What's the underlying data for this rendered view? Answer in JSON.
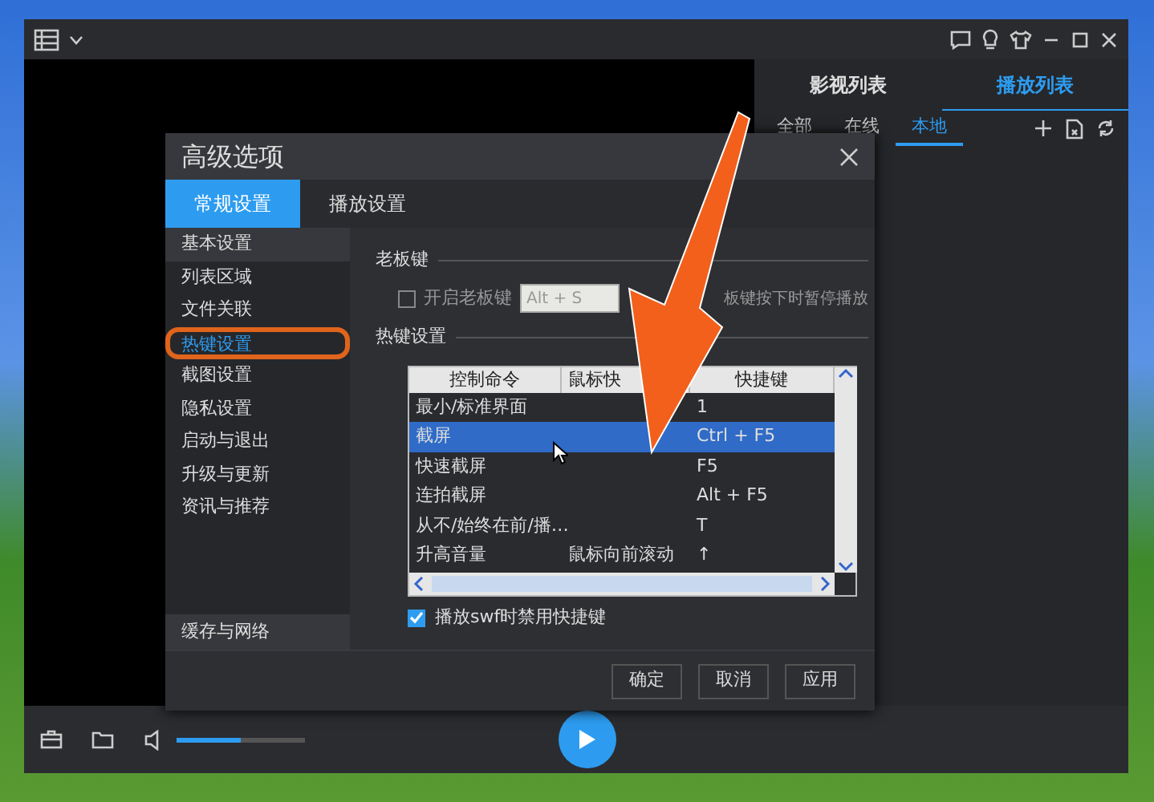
{
  "right_panel": {
    "tabs": [
      {
        "label": "影视列表",
        "selected": false
      },
      {
        "label": "播放列表",
        "selected": true
      }
    ],
    "sub_tabs": [
      {
        "label": "全部",
        "selected": false
      },
      {
        "label": "在线",
        "selected": false
      },
      {
        "label": "本地",
        "selected": true
      }
    ]
  },
  "dialog": {
    "title": "高级选项",
    "tabs": [
      {
        "label": "常规设置",
        "selected": true
      },
      {
        "label": "播放设置",
        "selected": false
      }
    ],
    "sidebar": {
      "items": [
        {
          "label": "基本设置",
          "selected": false,
          "hovered": true
        },
        {
          "label": "列表区域",
          "selected": false,
          "hovered": false
        },
        {
          "label": "文件关联",
          "selected": false,
          "hovered": false
        },
        {
          "label": "热键设置",
          "selected": true,
          "hovered": false,
          "circled": true
        },
        {
          "label": "截图设置",
          "selected": false,
          "hovered": false
        },
        {
          "label": "隐私设置",
          "selected": false,
          "hovered": false
        },
        {
          "label": "启动与退出",
          "selected": false,
          "hovered": false
        },
        {
          "label": "升级与更新",
          "selected": false,
          "hovered": false
        },
        {
          "label": "资讯与推荐",
          "selected": false,
          "hovered": false
        }
      ],
      "footer_item": "缓存与网络"
    },
    "boss_key": {
      "section_title": "老板键",
      "checkbox": {
        "label": "开启老板键",
        "checked": false
      },
      "field": {
        "value": "Alt + S"
      },
      "note": "板键按下时暂停播放"
    },
    "hotkeys": {
      "section_title": "热键设置",
      "columns": [
        "控制命令",
        "鼠标快",
        "快捷键"
      ],
      "rows": [
        {
          "cells": [
            "最小/标准界面",
            "",
            "1"
          ],
          "selected": false
        },
        {
          "cells": [
            "截屏",
            "",
            "Ctrl + F5"
          ],
          "selected": true
        },
        {
          "cells": [
            "快速截屏",
            "",
            "F5"
          ],
          "selected": false
        },
        {
          "cells": [
            "连拍截屏",
            "",
            "Alt + F5"
          ],
          "selected": false
        },
        {
          "cells": [
            "从不/始终在前/播…",
            "",
            "T"
          ],
          "selected": false
        },
        {
          "cells": [
            "升高音量",
            "鼠标向前滚动",
            "↑"
          ],
          "selected": false
        }
      ]
    },
    "swf_checkbox": {
      "label": "播放swf时禁用快捷键",
      "checked": true
    },
    "buttons": [
      "确定",
      "取消",
      "应用"
    ]
  },
  "player": {
    "volume": {
      "level": 0.5
    }
  }
}
